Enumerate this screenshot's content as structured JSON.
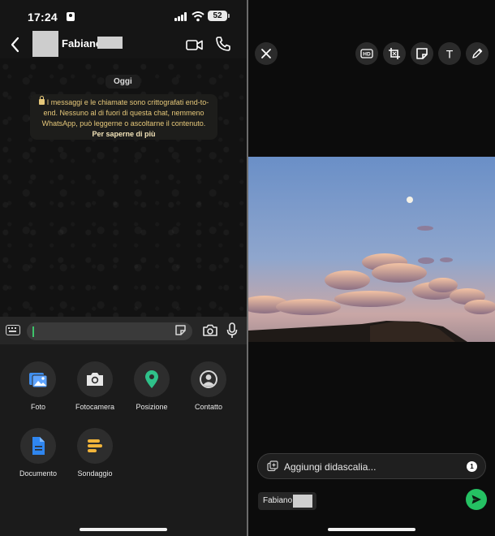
{
  "status_bar": {
    "time": "17:24",
    "battery": "52"
  },
  "chat_header": {
    "contact_name": "Fabiano"
  },
  "chat": {
    "date_label": "Oggi",
    "encryption_notice": "I messaggi e le chiamate sono crittografati end-to-end. Nessuno al di fuori di questa chat, nemmeno WhatsApp, può leggerne o ascoltarne il contenuto.",
    "encryption_link": "Per saperne di più"
  },
  "attach_menu": {
    "items": [
      {
        "label": "Foto",
        "icon": "gallery-icon",
        "color": "#3f8ff0"
      },
      {
        "label": "Fotocamera",
        "icon": "camera-icon",
        "color": "#e8e8e8"
      },
      {
        "label": "Posizione",
        "icon": "location-pin-icon",
        "color": "#2fc18a"
      },
      {
        "label": "Contatto",
        "icon": "contact-icon",
        "color": "#d8d8d8"
      },
      {
        "label": "Documento",
        "icon": "document-icon",
        "color": "#2f86f0"
      },
      {
        "label": "Sondaggio",
        "icon": "poll-icon",
        "color": "#f2b53a"
      }
    ]
  },
  "editor": {
    "tools": [
      "close-icon",
      "hd-icon",
      "crop-rotate-icon",
      "sticker-icon",
      "text-icon",
      "draw-icon"
    ],
    "hd_label": "HD",
    "text_label": "T",
    "caption_placeholder": "Aggiungi didascalia...",
    "photo_count": "1",
    "recipient_name": "Fabiano",
    "accent": "#25c163"
  }
}
